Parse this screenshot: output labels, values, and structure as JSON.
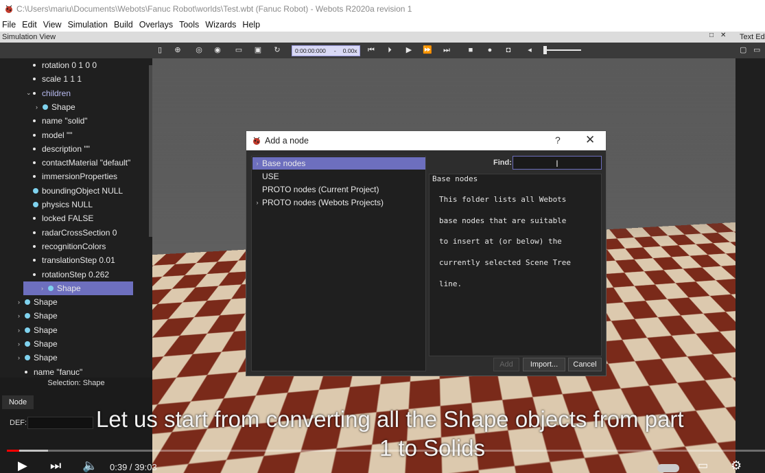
{
  "window": {
    "title": "C:\\Users\\mariu\\Documents\\Webots\\Fanuc Robot\\worlds\\Test.wbt (Fanuc Robot) - Webots R2020a revision 1"
  },
  "menu": [
    "File",
    "Edit",
    "View",
    "Simulation",
    "Build",
    "Overlays",
    "Tools",
    "Wizards",
    "Help"
  ],
  "docks": {
    "simulation_view_label": "Simulation View",
    "text_editor_label": "Text Ed",
    "dock_buttons": [
      "□",
      "✕"
    ]
  },
  "toolbar": {
    "time": "0:00:00:000",
    "speed_sep": "-",
    "speed": "0.00x"
  },
  "scene_tree": {
    "rows": [
      {
        "label": "rotation 0 1 0 0",
        "kind": "field",
        "indent": 2
      },
      {
        "label": "scale 1 1 1",
        "kind": "field",
        "indent": 2
      },
      {
        "label": "children",
        "kind": "expanded",
        "indent": 2
      },
      {
        "label": "Shape",
        "kind": "node-collapsed",
        "indent": 3
      },
      {
        "label": "name \"solid\"",
        "kind": "field",
        "indent": 2
      },
      {
        "label": "model \"\"",
        "kind": "field",
        "indent": 2
      },
      {
        "label": "description \"\"",
        "kind": "field",
        "indent": 2
      },
      {
        "label": "contactMaterial \"default\"",
        "kind": "field",
        "indent": 2
      },
      {
        "label": "immersionProperties",
        "kind": "field",
        "indent": 2
      },
      {
        "label": "boundingObject NULL",
        "kind": "node",
        "indent": 2
      },
      {
        "label": "physics NULL",
        "kind": "node",
        "indent": 2
      },
      {
        "label": "locked FALSE",
        "kind": "field",
        "indent": 2
      },
      {
        "label": "radarCrossSection 0",
        "kind": "field",
        "indent": 2
      },
      {
        "label": "recognitionColors",
        "kind": "field",
        "indent": 2
      },
      {
        "label": "translationStep 0.01",
        "kind": "field",
        "indent": 2
      },
      {
        "label": "rotationStep 0.262",
        "kind": "field",
        "indent": 2
      },
      {
        "label": "Shape",
        "kind": "node-collapsed",
        "indent": 1,
        "selected": true
      },
      {
        "label": "Shape",
        "kind": "node-collapsed",
        "indent": 1
      },
      {
        "label": "Shape",
        "kind": "node-collapsed",
        "indent": 1
      },
      {
        "label": "Shape",
        "kind": "node-collapsed",
        "indent": 1
      },
      {
        "label": "Shape",
        "kind": "node-collapsed",
        "indent": 1
      },
      {
        "label": "Shape",
        "kind": "node-collapsed",
        "indent": 1
      },
      {
        "label": "name \"fanuc\"",
        "kind": "field",
        "indent": 1
      }
    ],
    "selection_status": "Selection: Shape"
  },
  "node_panel": {
    "tab": "Node",
    "def_label": "DEF:",
    "def_value": ""
  },
  "dialog": {
    "title": "Add a node",
    "help": "?",
    "close": "✕",
    "items": [
      {
        "label": "Base nodes",
        "expandable": true,
        "selected": true
      },
      {
        "label": "USE",
        "expandable": false
      },
      {
        "label": "PROTO nodes (Current Project)",
        "expandable": false
      },
      {
        "label": "PROTO nodes (Webots Projects)",
        "expandable": true
      }
    ],
    "find_label": "Find:",
    "find_value": "",
    "description_title": "Base nodes",
    "description_lines": [
      "This folder lists all Webots",
      "base nodes that are suitable",
      "to insert at (or below) the",
      "currently selected Scene Tree",
      "line."
    ],
    "buttons": {
      "add": "Add",
      "import": "Import...",
      "cancel": "Cancel"
    }
  },
  "video": {
    "caption_line1": "Let us start from converting all the Shape objects from part",
    "caption_line2": "1 to Solids",
    "time_current": "0:39",
    "time_sep": " / ",
    "time_total": "39:03",
    "progress_fraction": 0.0167
  },
  "colors": {
    "selection": "#6d6fbe",
    "node_ball": "#7fd2ee",
    "progress_played": "#ff0000"
  }
}
